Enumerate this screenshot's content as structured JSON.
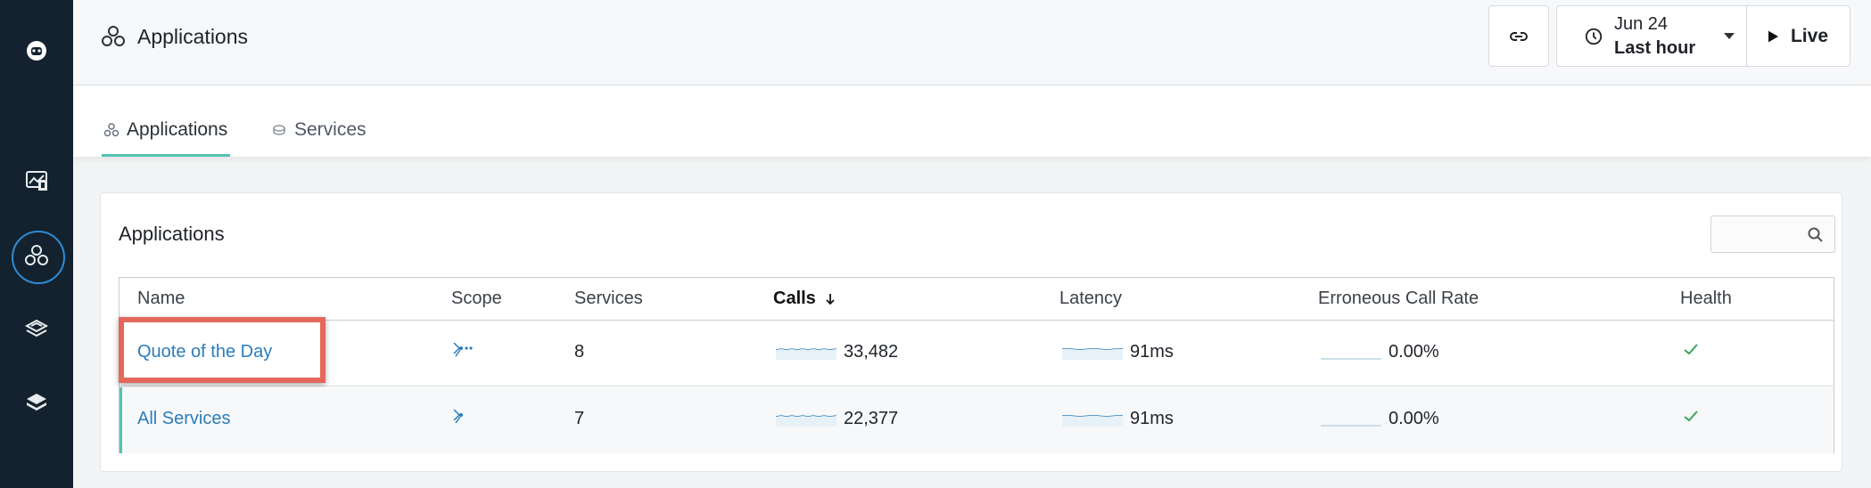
{
  "header": {
    "title": "Applications",
    "time_date": "Jun 24",
    "time_range": "Last hour",
    "live_label": "Live"
  },
  "tabs": [
    {
      "label": "Applications",
      "active": true
    },
    {
      "label": "Services",
      "active": false
    }
  ],
  "card": {
    "title": "Applications",
    "search_placeholder": ""
  },
  "table": {
    "columns": [
      "Name",
      "Scope",
      "Services",
      "Calls",
      "Latency",
      "Erroneous Call Rate",
      "Health"
    ],
    "sorted_column": "Calls",
    "rows": [
      {
        "name": "Quote of the Day",
        "services": "8",
        "calls": "33,482",
        "latency": "91ms",
        "error_rate": "0.00%",
        "health": "check-icon"
      },
      {
        "name": "All Services",
        "services": "7",
        "calls": "22,377",
        "latency": "91ms",
        "error_rate": "0.00%",
        "health": "check-icon"
      }
    ]
  },
  "colors": {
    "rail": "#13222e",
    "accent": "#53c2b0",
    "link": "#2b7db9",
    "highlight": "#e4675b",
    "health_ok": "#3aa35a"
  }
}
